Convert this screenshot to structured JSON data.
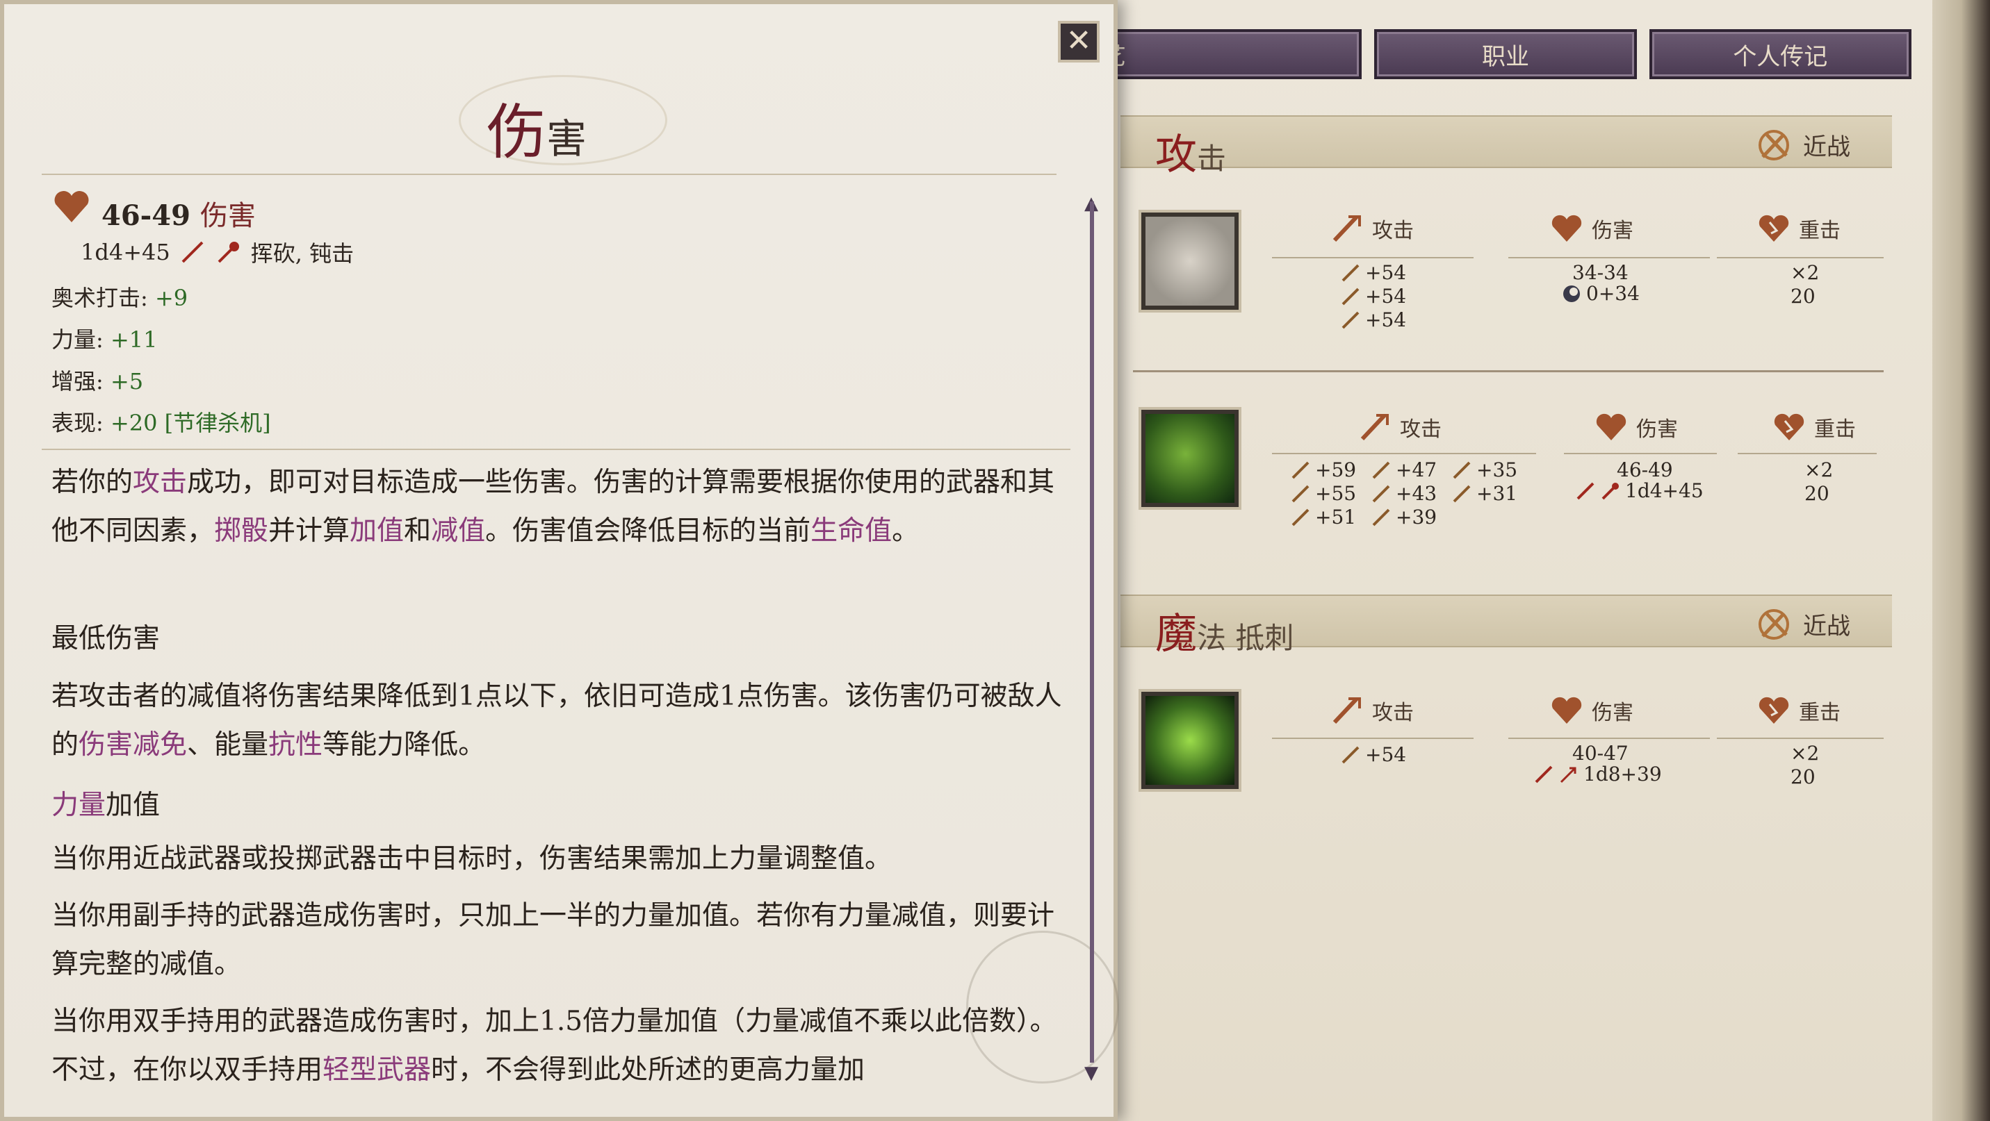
{
  "tabs": [
    {
      "label": "艺"
    },
    {
      "label": "职业"
    },
    {
      "label": "个人传记"
    }
  ],
  "sections": {
    "attack": {
      "title_main": "攻",
      "title_rest": "击",
      "mode": "近战"
    },
    "magic": {
      "title_main": "魔",
      "title_rest": "法 抵刺",
      "mode": "近战"
    }
  },
  "weapons": [
    {
      "name": "fist",
      "col_attack": "攻击",
      "col_damage": "伤害",
      "col_crit": "重击",
      "attack_values": [
        "+54",
        "+54",
        "+54"
      ],
      "damage_main": "34-34",
      "damage_sub": "0+34",
      "crit_mult": "×2",
      "crit_range": "20"
    },
    {
      "name": "claw",
      "col_attack": "攻击",
      "col_damage": "伤害",
      "col_crit": "重击",
      "attack_values": [
        "+59",
        "+47",
        "+35",
        "+55",
        "+43",
        "+31",
        "+51",
        "+39"
      ],
      "damage_main": "46-49",
      "damage_sub": "1d4+45",
      "crit_mult": "×2",
      "crit_range": "20"
    },
    {
      "name": "spore",
      "col_attack": "攻击",
      "col_damage": "伤害",
      "col_crit": "重击",
      "attack_values": [
        "+54"
      ],
      "damage_main": "40-47",
      "damage_sub": "1d8+39",
      "crit_mult": "×2",
      "crit_range": "20"
    }
  ],
  "tooltip": {
    "close": "✕",
    "title_big": "伤",
    "title_small": "害",
    "damage_range": "46-49",
    "damage_label": "伤害",
    "dice": "1d4+45",
    "damage_types": "挥砍, 钝击",
    "stats": [
      {
        "label": "奥术打击: ",
        "value": "+9"
      },
      {
        "label": "力量: ",
        "value": "+11"
      },
      {
        "label": "增强: ",
        "value": "+5"
      },
      {
        "label": "表现: ",
        "value": "+20 [节律杀机]"
      }
    ],
    "para1": {
      "a": "若你的",
      "k1": "攻击",
      "b": "成功，即可对目标造成一些伤害。伤害的计算需要根据你使用的武器和其他不同因素，",
      "k2": "掷骰",
      "c": "并计算",
      "k3": "加值",
      "d": "和",
      "k4": "减值",
      "e": "。伤害值会降低目标的当前",
      "k5": "生命值",
      "f": "。"
    },
    "h_min": "最低伤害",
    "para2": {
      "a": "若攻击者的减值将伤害结果降低到1点以下，依旧可造成1点伤害。该伤害仍可被敌人的",
      "k1": "伤害减免",
      "b": "、能量",
      "k2": "抗性",
      "c": "等能力降低。"
    },
    "h_str_kw": "力量",
    "h_str_rest": "加值",
    "para3": "当你用近战武器或投掷武器击中目标时，伤害结果需加上力量调整值。",
    "para4": "当你用副手持的武器造成伤害时，只加上一半的力量加值。若你有力量减值，则要计算完整的减值。",
    "para5": {
      "a": "当你用双手持用的武器造成伤害时，加上1.5倍力量加值（力量减值不乘以此倍数）。不过，在你以双手持用",
      "k1": "轻型武器",
      "b": "时，不会得到此处所述的更高力量加"
    }
  },
  "colors": {
    "accent_red": "#8a1e1e",
    "keyword_purple": "#8a3a7a",
    "stat_green": "#2e6a26",
    "tab_purple": "#4a3a52"
  }
}
